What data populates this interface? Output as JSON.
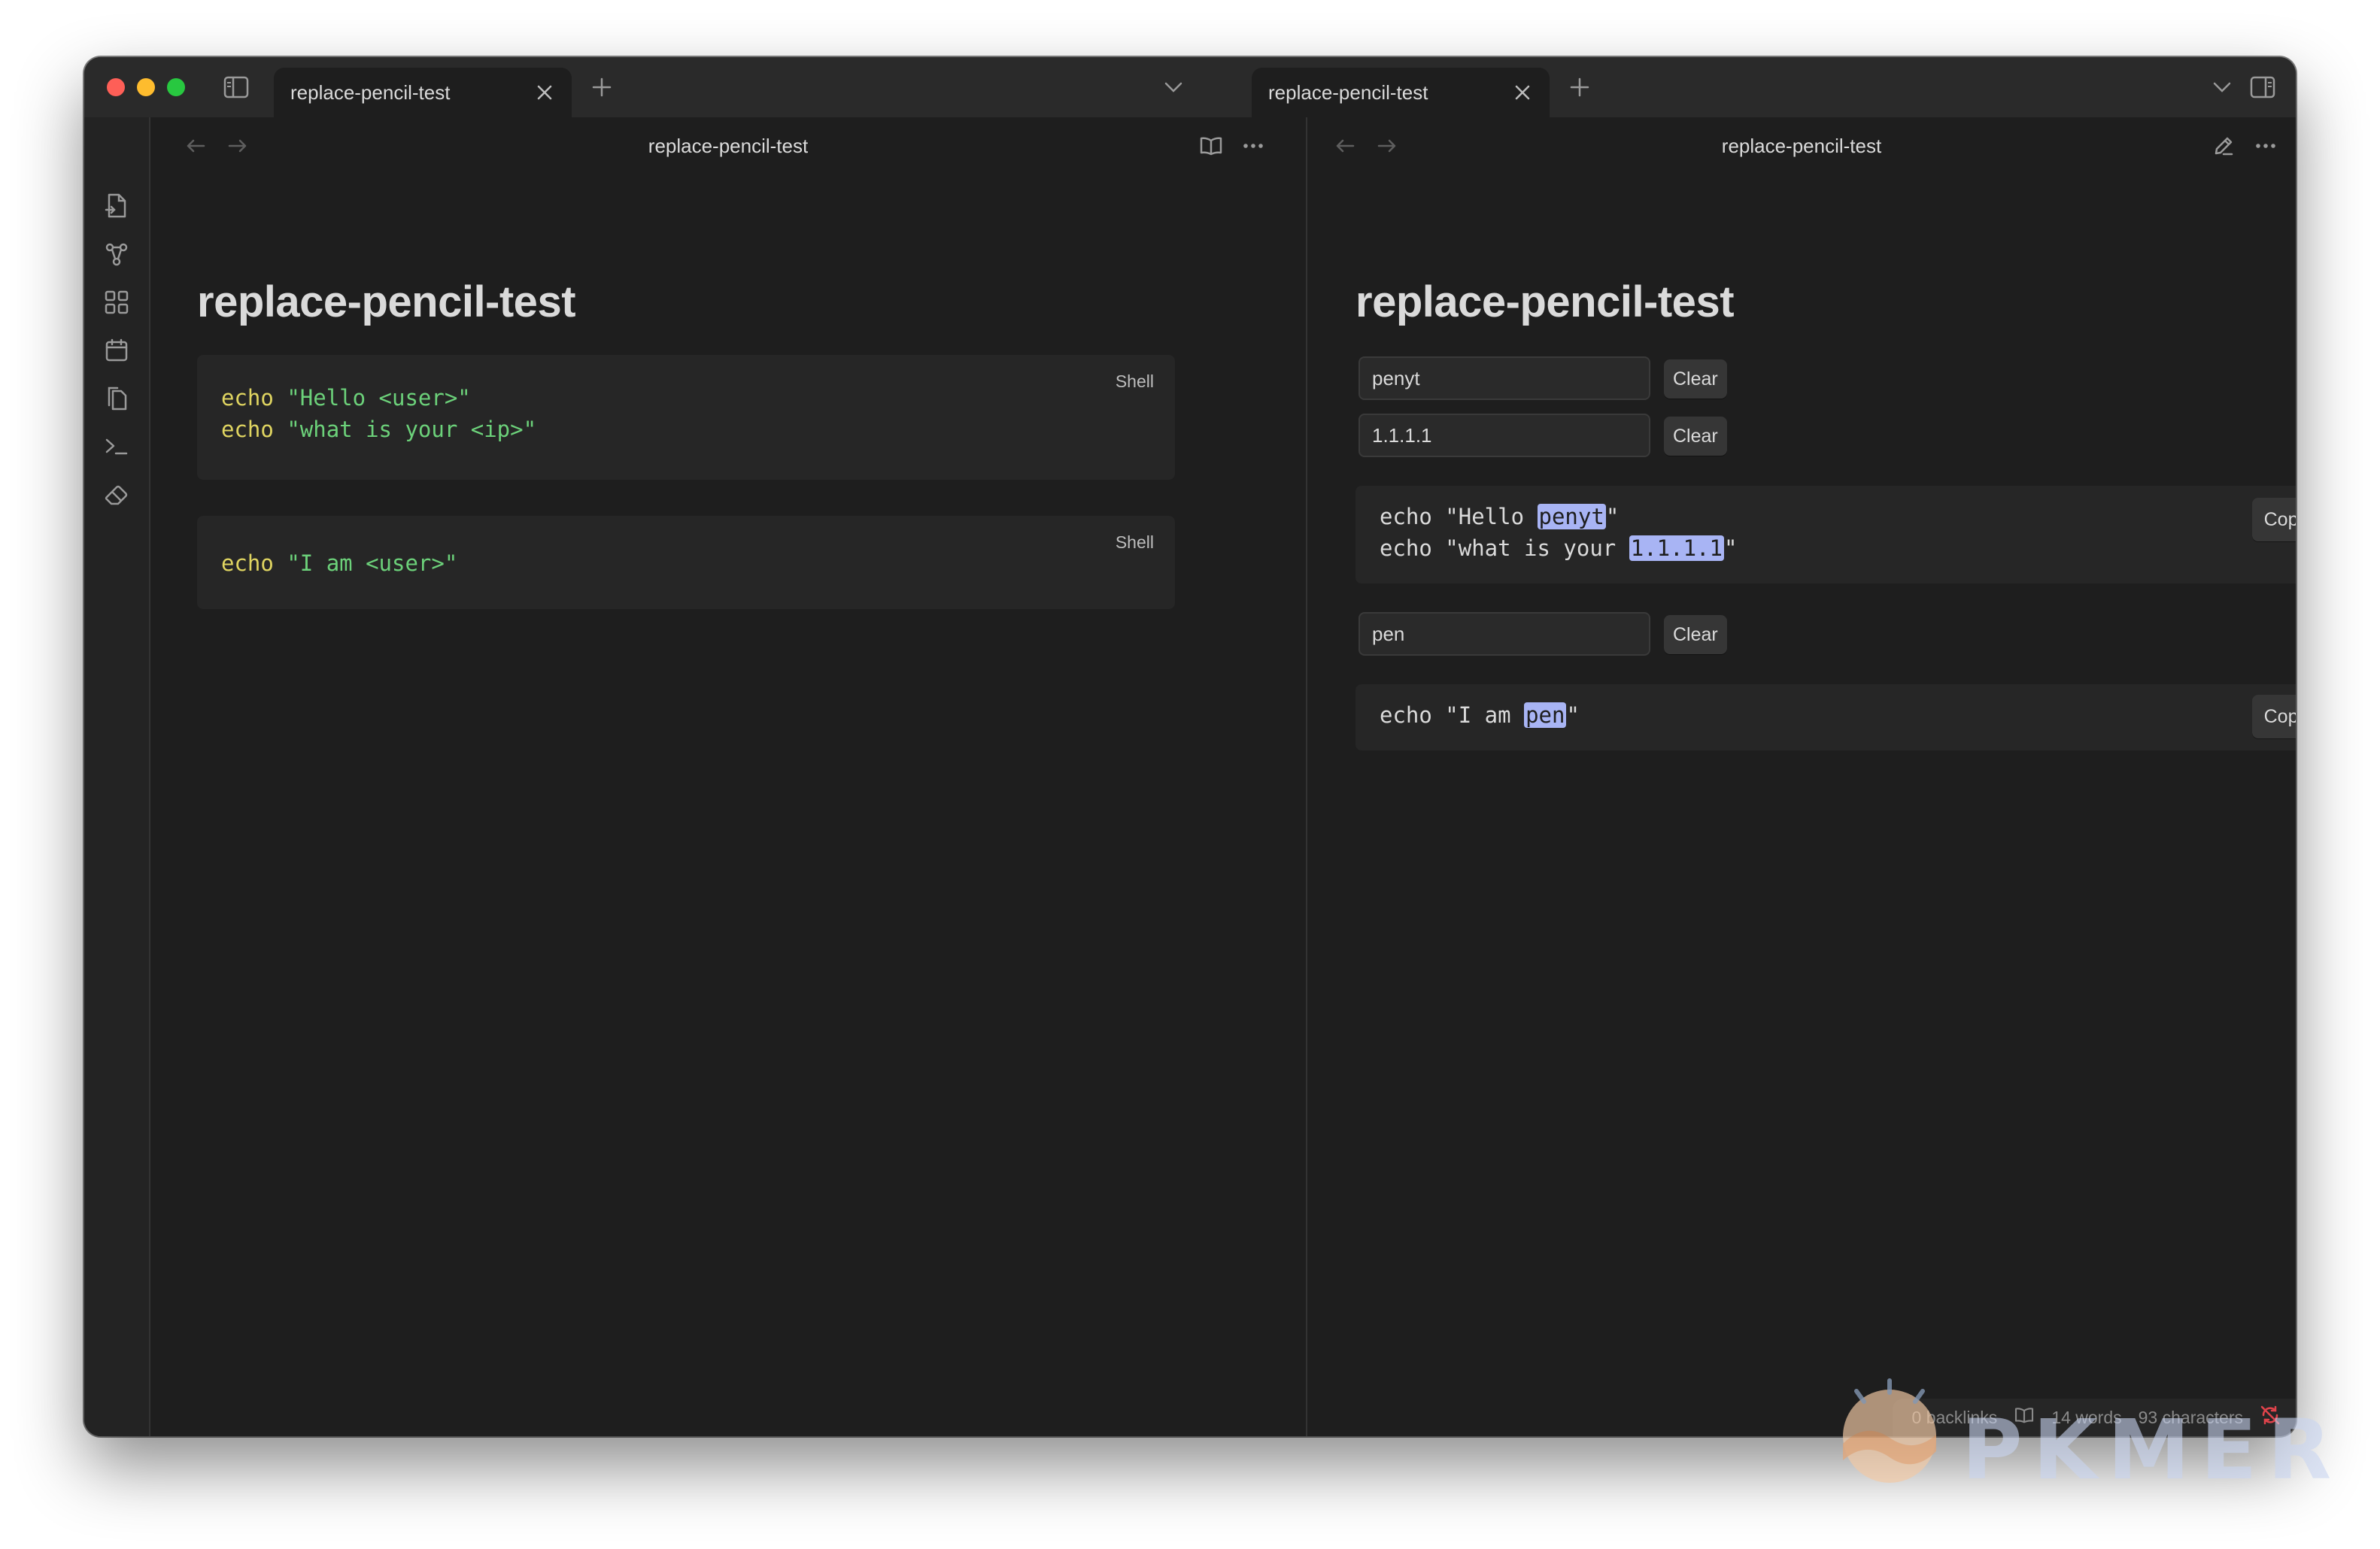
{
  "left_tab": {
    "label": "replace-pencil-test"
  },
  "right_tab": {
    "label": "replace-pencil-test"
  },
  "left_pane": {
    "header_title": "replace-pencil-test",
    "note_title": "replace-pencil-test",
    "code_blocks": [
      {
        "language": "Shell",
        "lines": [
          {
            "cmd": "echo",
            "arg": "\"Hello <user>\""
          },
          {
            "cmd": "echo",
            "arg": "\"what is your <ip>\""
          }
        ]
      },
      {
        "language": "Shell",
        "lines": [
          {
            "cmd": "echo",
            "arg": "\"I am <user>\""
          }
        ]
      }
    ]
  },
  "right_pane": {
    "header_title": "replace-pencil-test",
    "note_title": "replace-pencil-test",
    "inputs": [
      {
        "value": "penyt",
        "clear_label": "Clear"
      },
      {
        "value": "1.1.1.1",
        "clear_label": "Clear"
      },
      {
        "value": "pen",
        "clear_label": "Clear"
      }
    ],
    "blocks": [
      {
        "copy_label": "Copy",
        "lines": [
          {
            "prefix": "echo \"Hello ",
            "highlight": "penyt",
            "suffix": "\""
          },
          {
            "prefix": "echo \"what is your ",
            "highlight": "1.1.1.1",
            "suffix": "\""
          }
        ]
      },
      {
        "copy_label": "Copy",
        "lines": [
          {
            "prefix": "echo \"I am ",
            "highlight": "pen",
            "suffix": "\""
          }
        ]
      }
    ]
  },
  "status_bar": {
    "backlinks": "0 backlinks",
    "words": "14 words",
    "characters": "93 characters"
  },
  "watermark": {
    "text": "PKMER"
  },
  "colors": {
    "background": "#1e1e1e",
    "titlebar": "#2a2a2a",
    "code_block": "#262626",
    "keyword": "#e0d561",
    "string": "#6cd17a",
    "highlight": "#a8b4f4"
  },
  "icons": {
    "ribbon": [
      "new-note-icon",
      "graph-icon",
      "canvas-icon",
      "calendar-icon",
      "files-icon",
      "terminal-icon",
      "eraser-icon"
    ]
  }
}
